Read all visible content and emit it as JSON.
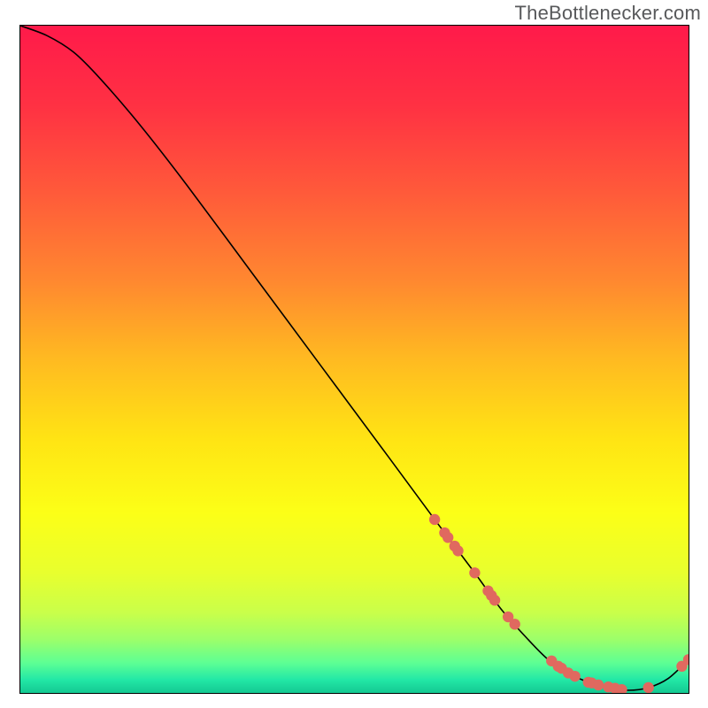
{
  "attribution": "TheBottlenecker.com",
  "chart_data": {
    "type": "line",
    "title": "",
    "xlabel": "",
    "ylabel": "",
    "xlim": [
      0,
      100
    ],
    "ylim": [
      0,
      100
    ],
    "series": [
      {
        "name": "curve",
        "x": [
          0,
          4,
          8,
          12,
          18,
          25,
          35,
          45,
          55,
          62,
          68,
          72,
          76,
          79,
          82,
          85,
          88,
          91,
          94,
          97,
          100
        ],
        "y": [
          100,
          98.5,
          96,
          92,
          85,
          76,
          62.5,
          49,
          35.5,
          26,
          18,
          12.5,
          8,
          5,
          3,
          1.6,
          0.8,
          0.4,
          0.8,
          2.2,
          5
        ]
      }
    ],
    "markers": [
      {
        "x": 62,
        "y": 26.0
      },
      {
        "x": 63.5,
        "y": 24.0
      },
      {
        "x": 64.0,
        "y": 23.3
      },
      {
        "x": 65.0,
        "y": 22.0
      },
      {
        "x": 65.5,
        "y": 21.3
      },
      {
        "x": 68.0,
        "y": 18.0
      },
      {
        "x": 70.0,
        "y": 15.3
      },
      {
        "x": 70.5,
        "y": 14.6
      },
      {
        "x": 71.0,
        "y": 13.9
      },
      {
        "x": 73.0,
        "y": 11.4
      },
      {
        "x": 74.0,
        "y": 10.3
      },
      {
        "x": 79.5,
        "y": 4.8
      },
      {
        "x": 80.5,
        "y": 4.0
      },
      {
        "x": 81.0,
        "y": 3.7
      },
      {
        "x": 82.0,
        "y": 3.0
      },
      {
        "x": 83.0,
        "y": 2.5
      },
      {
        "x": 85.0,
        "y": 1.6
      },
      {
        "x": 85.5,
        "y": 1.5
      },
      {
        "x": 86.5,
        "y": 1.2
      },
      {
        "x": 88.0,
        "y": 0.9
      },
      {
        "x": 89.0,
        "y": 0.7
      },
      {
        "x": 90.0,
        "y": 0.5
      },
      {
        "x": 94.0,
        "y": 0.8
      },
      {
        "x": 99.0,
        "y": 4.0
      },
      {
        "x": 100.0,
        "y": 5.0
      }
    ],
    "gradient_stops": [
      {
        "pos": 0.0,
        "color": "#ff1a4a"
      },
      {
        "pos": 0.12,
        "color": "#ff3143"
      },
      {
        "pos": 0.25,
        "color": "#ff5a3a"
      },
      {
        "pos": 0.38,
        "color": "#ff8730"
      },
      {
        "pos": 0.5,
        "color": "#ffba21"
      },
      {
        "pos": 0.62,
        "color": "#ffe414"
      },
      {
        "pos": 0.73,
        "color": "#fcff17"
      },
      {
        "pos": 0.82,
        "color": "#e8ff2e"
      },
      {
        "pos": 0.88,
        "color": "#c9ff4a"
      },
      {
        "pos": 0.92,
        "color": "#9cff6a"
      },
      {
        "pos": 0.955,
        "color": "#5dff94"
      },
      {
        "pos": 0.98,
        "color": "#23e8a6"
      },
      {
        "pos": 1.0,
        "color": "#14c992"
      }
    ],
    "marker_color": "#e0695f",
    "line_color": "#000000"
  }
}
